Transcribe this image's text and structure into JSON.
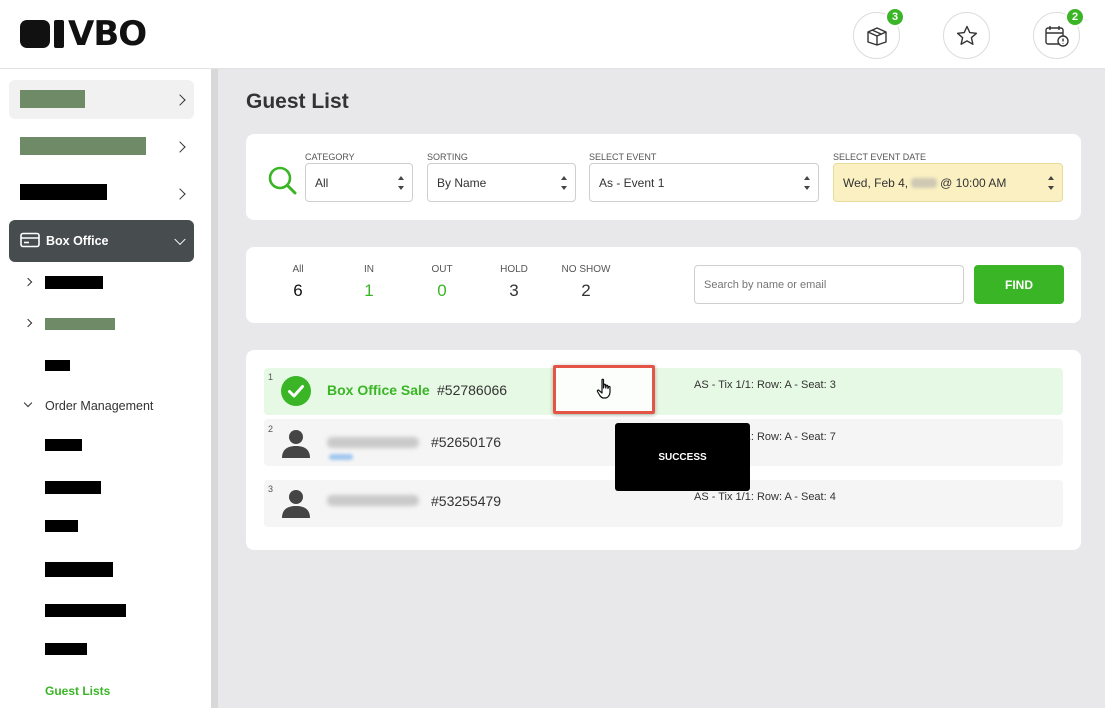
{
  "header": {
    "logo_text": "VBO",
    "icons": [
      {
        "name": "box-icon",
        "badge": "3"
      },
      {
        "name": "star-icon",
        "badge": ""
      },
      {
        "name": "calendar-alert-icon",
        "badge": "2"
      }
    ]
  },
  "sidebar": {
    "box_office_label": "Box Office",
    "order_management_label": "Order Management",
    "guest_lists_label": "Guest Lists"
  },
  "main": {
    "title": "Guest List",
    "filters": {
      "category_label": "CATEGORY",
      "category_value": "All",
      "sorting_label": "SORTING",
      "sorting_value": "By Name",
      "event_label": "SELECT EVENT",
      "event_value": "As - Event 1",
      "date_label": "SELECT EVENT DATE",
      "date_prefix": "Wed, Feb 4,",
      "date_suffix": "@ 10:00 AM"
    },
    "stats": [
      {
        "label": "All",
        "value": "6"
      },
      {
        "label": "IN",
        "value": "1"
      },
      {
        "label": "OUT",
        "value": "0"
      },
      {
        "label": "HOLD",
        "value": "3"
      },
      {
        "label": "NO SHOW",
        "value": "2"
      }
    ],
    "search_placeholder": "Search by name or email",
    "find_label": "FIND",
    "rows": [
      {
        "num": "1",
        "name": "Box Office Sale",
        "order": "#52786066",
        "seat": "AS - Tix 1/1: Row: A - Seat: 3"
      },
      {
        "num": "2",
        "name": "",
        "order": "#52650176",
        "seat": "AS - Tix 1/1: Row: A - Seat: 7"
      },
      {
        "num": "3",
        "name": "",
        "order": "#53255479",
        "seat": "AS - Tix 1/1: Row: A - Seat: 4"
      }
    ],
    "toast": "SUCCESS"
  },
  "colors": {
    "accent": "#3ab526",
    "dark_nav": "#474d4e",
    "highlight": "#e45447"
  }
}
